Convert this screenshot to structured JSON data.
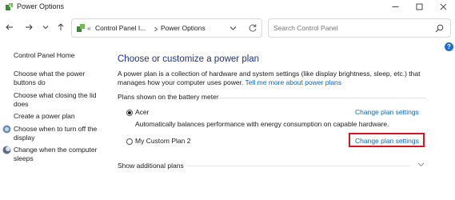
{
  "window": {
    "title": "Power Options"
  },
  "address": {
    "path_parent": "Control Panel I...",
    "path_current": "Power Options"
  },
  "search": {
    "placeholder": "Search Control Panel"
  },
  "sidebar": {
    "items": [
      {
        "label": "Control Panel Home"
      },
      {
        "label": "Choose what the power buttons do"
      },
      {
        "label": "Choose what closing the lid does"
      },
      {
        "label": "Create a power plan"
      },
      {
        "label": "Choose when to turn off the display"
      },
      {
        "label": "Change when the computer sleeps"
      }
    ]
  },
  "main": {
    "heading": "Choose or customize a power plan",
    "description": "A power plan is a collection of hardware and system settings (like display brightness, sleep, etc.) that manages how your computer uses power. ",
    "description_link": "Tell me more about power plans",
    "group_label": "Plans shown on the battery meter",
    "plans": [
      {
        "name": "Acer",
        "selected": true,
        "description": "Automatically balances performance with energy consumption on capable hardware.",
        "link": "Change plan settings"
      },
      {
        "name": "My Custom Plan 2",
        "selected": false,
        "link": "Change plan settings"
      }
    ],
    "show_more": "Show additional plans"
  },
  "colors": {
    "heading": "#1e3287",
    "link": "#0a66c2",
    "highlight": "#d8141f"
  }
}
